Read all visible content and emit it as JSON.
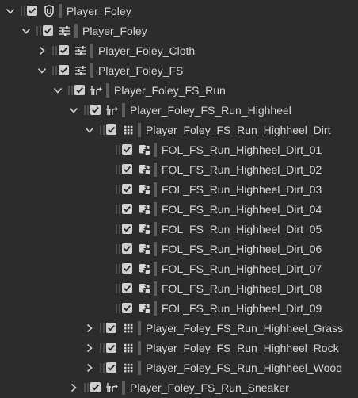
{
  "tree": {
    "rows": [
      {
        "label": "Player_Foley",
        "icon": "actor-mixer-icon",
        "expand": "expanded",
        "depth": 0
      },
      {
        "label": "Player_Foley",
        "icon": "sliders-icon",
        "expand": "expanded",
        "depth": 1
      },
      {
        "label": "Player_Foley_Cloth",
        "icon": "sliders-icon",
        "expand": "collapsed",
        "depth": 2
      },
      {
        "label": "Player_Foley_FS",
        "icon": "sliders-icon",
        "expand": "expanded",
        "depth": 2
      },
      {
        "label": "Player_Foley_FS_Run",
        "icon": "switch-container-icon",
        "expand": "expanded",
        "depth": 3
      },
      {
        "label": "Player_Foley_FS_Run_Highheel",
        "icon": "switch-container-icon",
        "expand": "expanded",
        "depth": 4
      },
      {
        "label": "Player_Foley_FS_Run_Highheel_Dirt",
        "icon": "random-container-icon",
        "expand": "expanded",
        "depth": 5
      },
      {
        "label": "FOL_FS_Run_Highheel_Dirt_01",
        "icon": "sound-sfx-icon",
        "expand": "none",
        "depth": 6
      },
      {
        "label": "FOL_FS_Run_Highheel_Dirt_02",
        "icon": "sound-sfx-icon",
        "expand": "none",
        "depth": 6
      },
      {
        "label": "FOL_FS_Run_Highheel_Dirt_03",
        "icon": "sound-sfx-icon",
        "expand": "none",
        "depth": 6
      },
      {
        "label": "FOL_FS_Run_Highheel_Dirt_04",
        "icon": "sound-sfx-icon",
        "expand": "none",
        "depth": 6
      },
      {
        "label": "FOL_FS_Run_Highheel_Dirt_05",
        "icon": "sound-sfx-icon",
        "expand": "none",
        "depth": 6
      },
      {
        "label": "FOL_FS_Run_Highheel_Dirt_06",
        "icon": "sound-sfx-icon",
        "expand": "none",
        "depth": 6
      },
      {
        "label": "FOL_FS_Run_Highheel_Dirt_07",
        "icon": "sound-sfx-icon",
        "expand": "none",
        "depth": 6
      },
      {
        "label": "FOL_FS_Run_Highheel_Dirt_08",
        "icon": "sound-sfx-icon",
        "expand": "none",
        "depth": 6
      },
      {
        "label": "FOL_FS_Run_Highheel_Dirt_09",
        "icon": "sound-sfx-icon",
        "expand": "none",
        "depth": 6
      },
      {
        "label": "Player_Foley_FS_Run_Highheel_Grass",
        "icon": "random-container-icon",
        "expand": "collapsed",
        "depth": 5
      },
      {
        "label": "Player_Foley_FS_Run_Highheel_Rock",
        "icon": "random-container-icon",
        "expand": "collapsed",
        "depth": 5
      },
      {
        "label": "Player_Foley_FS_Run_Highheel_Wood",
        "icon": "random-container-icon",
        "expand": "collapsed",
        "depth": 5
      },
      {
        "label": "Player_Foley_FS_Run_Sneaker",
        "icon": "switch-container-icon",
        "expand": "collapsed",
        "depth": 4
      }
    ]
  },
  "colors": {
    "background": "#2c2c2c",
    "text": "#d4d4d4",
    "checkbox": "#cfcfcf",
    "icon": "#d6d6d6"
  }
}
